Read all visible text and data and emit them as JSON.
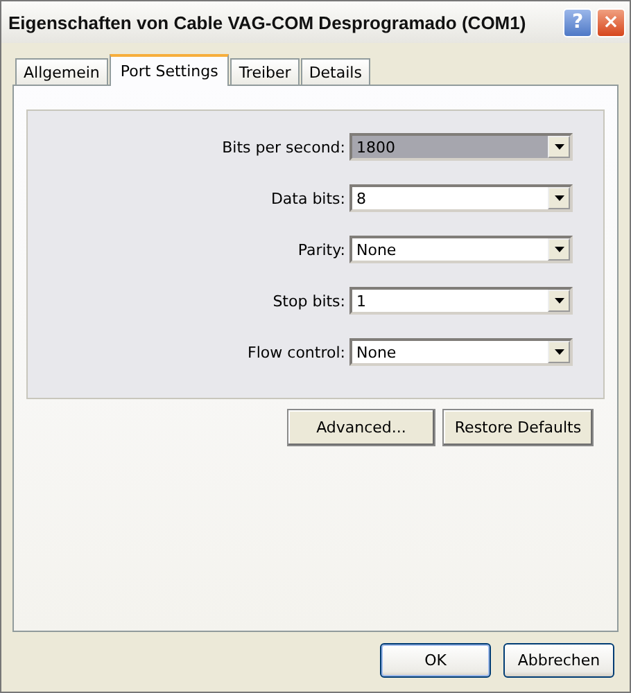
{
  "window": {
    "title": "Eigenschaften von Cable VAG-COM Desprogramado (COM1)",
    "help_button": "?",
    "close_button": "×"
  },
  "tabs": [
    {
      "label": "Allgemein",
      "selected": false
    },
    {
      "label": "Port Settings",
      "selected": true
    },
    {
      "label": "Treiber",
      "selected": false
    },
    {
      "label": "Details",
      "selected": false
    }
  ],
  "settings": [
    {
      "label": "Bits per second:",
      "value": "1800",
      "focused": true
    },
    {
      "label": "Data bits:",
      "value": "8",
      "focused": false
    },
    {
      "label": "Parity:",
      "value": "None",
      "focused": false
    },
    {
      "label": "Stop bits:",
      "value": "1",
      "focused": false
    },
    {
      "label": "Flow control:",
      "value": "None",
      "focused": false
    }
  ],
  "panel_buttons": [
    "Advanced...",
    "Restore Defaults"
  ],
  "dialog_buttons": [
    {
      "label": "OK",
      "default": true
    },
    {
      "label": "Abbrechen",
      "default": false
    }
  ]
}
